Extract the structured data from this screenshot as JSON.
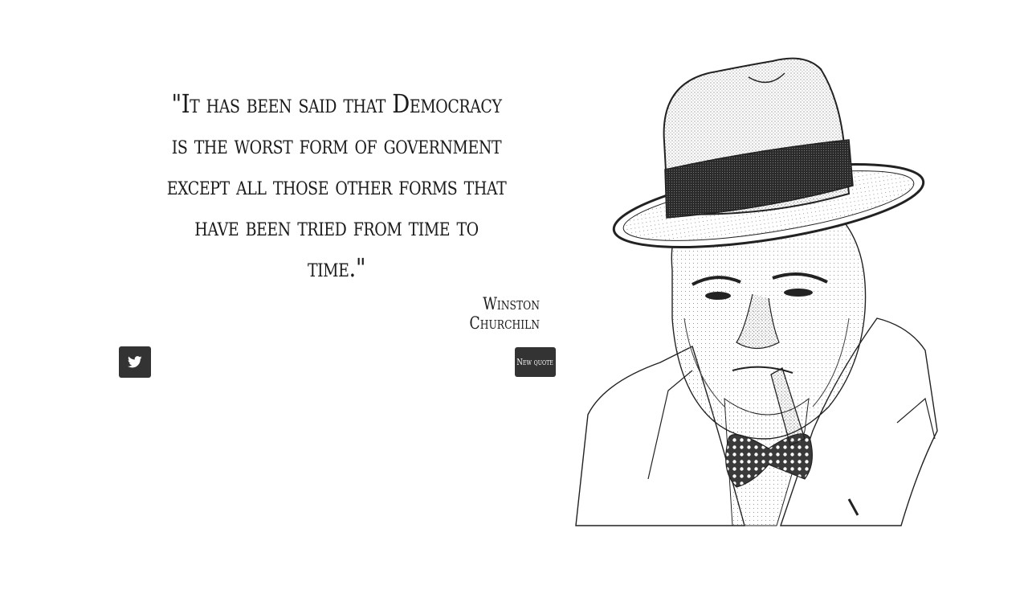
{
  "quote": {
    "text": "\"It has been said that Democracy is the worst form of government except all those other forms that have been tried from time to time.\"",
    "author": "Winston Churchiln"
  },
  "buttons": {
    "tweet_icon": "twitter-icon",
    "new_quote_label": "New quote"
  },
  "colors": {
    "button_bg": "#333333",
    "text": "#1b1b1b",
    "background": "#ffffff"
  }
}
